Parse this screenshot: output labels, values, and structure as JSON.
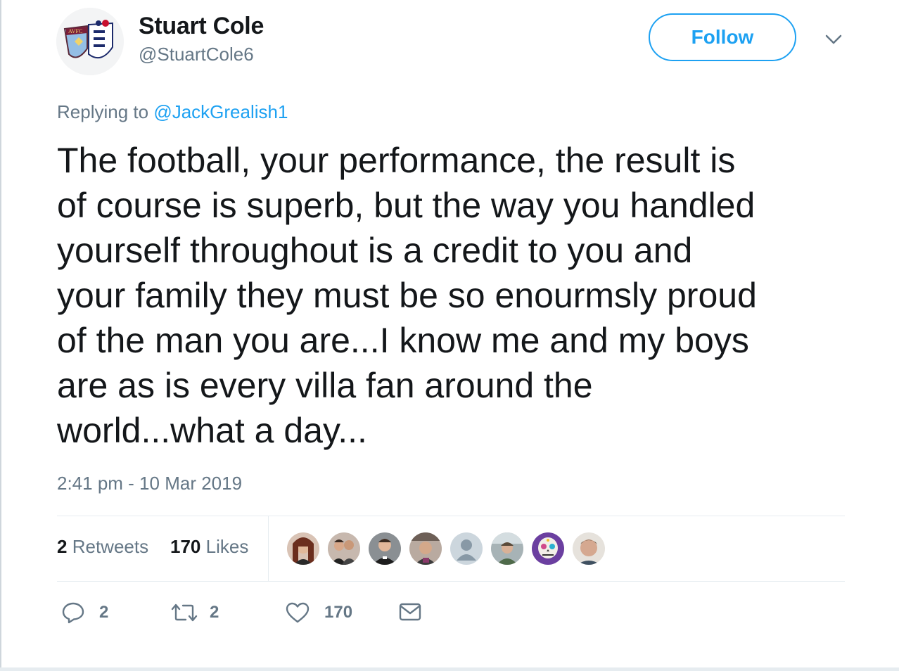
{
  "user": {
    "display_name": "Stuart Cole",
    "handle": "@StuartCole6"
  },
  "follow_button": {
    "label": "Follow"
  },
  "reply": {
    "prefix": "Replying to ",
    "mention": "@JackGrealish1"
  },
  "tweet": {
    "lines": [
      "The football, your performance, the result is",
      "of course is superb, but the way you handled",
      "yourself throughout is a credit to you and",
      "your family they must be so enourmsly proud",
      "of the man you are...I know me and my boys",
      "are as is every villa fan around the",
      "world...what a day..."
    ],
    "timestamp": "2:41 pm - 10 Mar 2019"
  },
  "stats": {
    "retweets_count": "2",
    "retweets_label": "Retweets",
    "likes_count": "170",
    "likes_label": "Likes"
  },
  "likers": [
    {
      "name": "liker-1",
      "color": "#8a4a3a"
    },
    {
      "name": "liker-2",
      "color": "#5b4a44"
    },
    {
      "name": "liker-3",
      "color": "#3e4a4e"
    },
    {
      "name": "liker-4",
      "color": "#6a5750"
    },
    {
      "name": "liker-5",
      "color": "#ccd6dd"
    },
    {
      "name": "liker-6",
      "color": "#7d8a8c"
    },
    {
      "name": "liker-7",
      "color": "#6b3fa0"
    },
    {
      "name": "liker-8",
      "color": "#c9a28a"
    }
  ],
  "actions": {
    "replies": "2",
    "retweets": "2",
    "likes": "170"
  },
  "icons": {
    "reply": "reply-icon",
    "retweet": "retweet-icon",
    "like": "heart-icon",
    "dm": "envelope-icon",
    "more": "chevron-down-icon"
  },
  "colors": {
    "accent": "#1da1f2",
    "secondary_text": "#657786",
    "primary_text": "#14171a"
  }
}
